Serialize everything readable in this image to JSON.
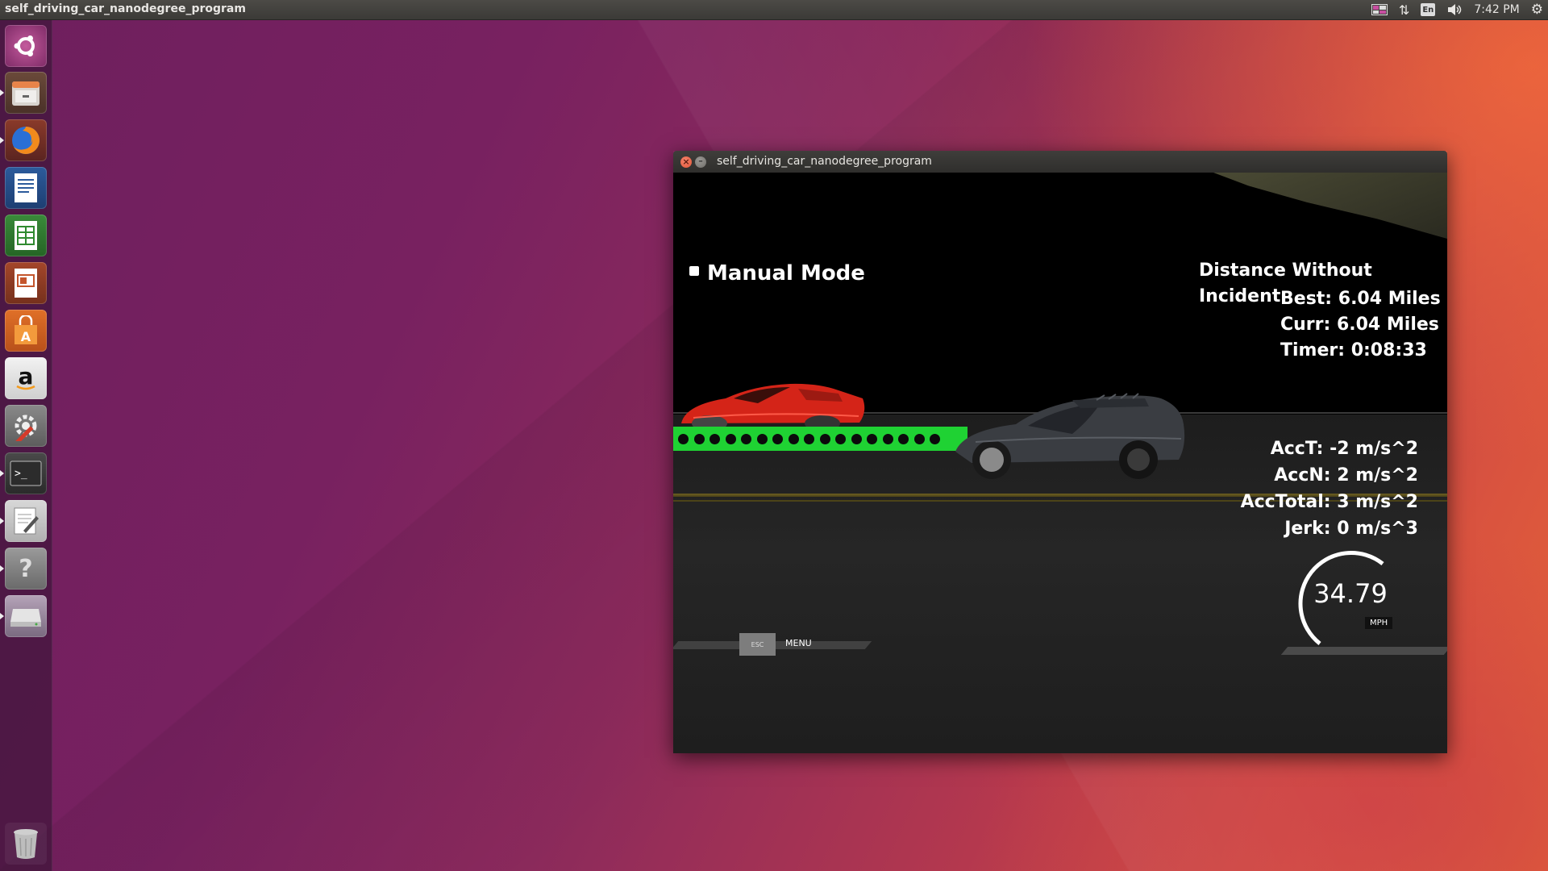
{
  "desktop": {
    "panel_title": "self_driving_car_nanodegree_program",
    "clock": "7:42 PM",
    "keyboard_layout": "En"
  },
  "launcher": {
    "items": [
      {
        "name": "ubuntu-dash",
        "icon": "ubuntu-logo-icon"
      },
      {
        "name": "files",
        "icon": "file-cabinet-icon"
      },
      {
        "name": "firefox",
        "icon": "firefox-icon"
      },
      {
        "name": "libreoffice-writer",
        "icon": "writer-icon"
      },
      {
        "name": "libreoffice-calc",
        "icon": "calc-icon"
      },
      {
        "name": "libreoffice-impress",
        "icon": "impress-icon"
      },
      {
        "name": "software-center",
        "icon": "shopping-bag-icon"
      },
      {
        "name": "amazon",
        "icon": "amazon-icon"
      },
      {
        "name": "system-settings",
        "icon": "settings-tools-icon"
      },
      {
        "name": "terminal",
        "icon": "terminal-icon"
      },
      {
        "name": "text-editor",
        "icon": "text-editor-icon"
      },
      {
        "name": "help",
        "icon": "help-icon"
      },
      {
        "name": "drive",
        "icon": "hard-drive-icon"
      },
      {
        "name": "trash",
        "icon": "trash-icon"
      }
    ]
  },
  "window": {
    "title": "self_driving_car_nanodegree_program"
  },
  "game": {
    "mode": "Manual Mode",
    "distance_heading": "Distance Without Incident",
    "best": "Best: 6.04 Miles",
    "curr": "Curr: 6.04 Miles",
    "timer": "Timer: 0:08:33",
    "acc_t": "AccT: -2 m/s^2",
    "acc_n": "AccN: 2 m/s^2",
    "acc_total": "AccTotal: 3 m/s^2",
    "jerk": "Jerk: 0 m/s^3",
    "speed": "34.79",
    "speed_unit": "MPH",
    "esc_key": "ESC",
    "menu": "MENU",
    "colors": {
      "path": "#1fd233",
      "red_car": "#d42418",
      "ego_car": "#3a3d42"
    }
  }
}
